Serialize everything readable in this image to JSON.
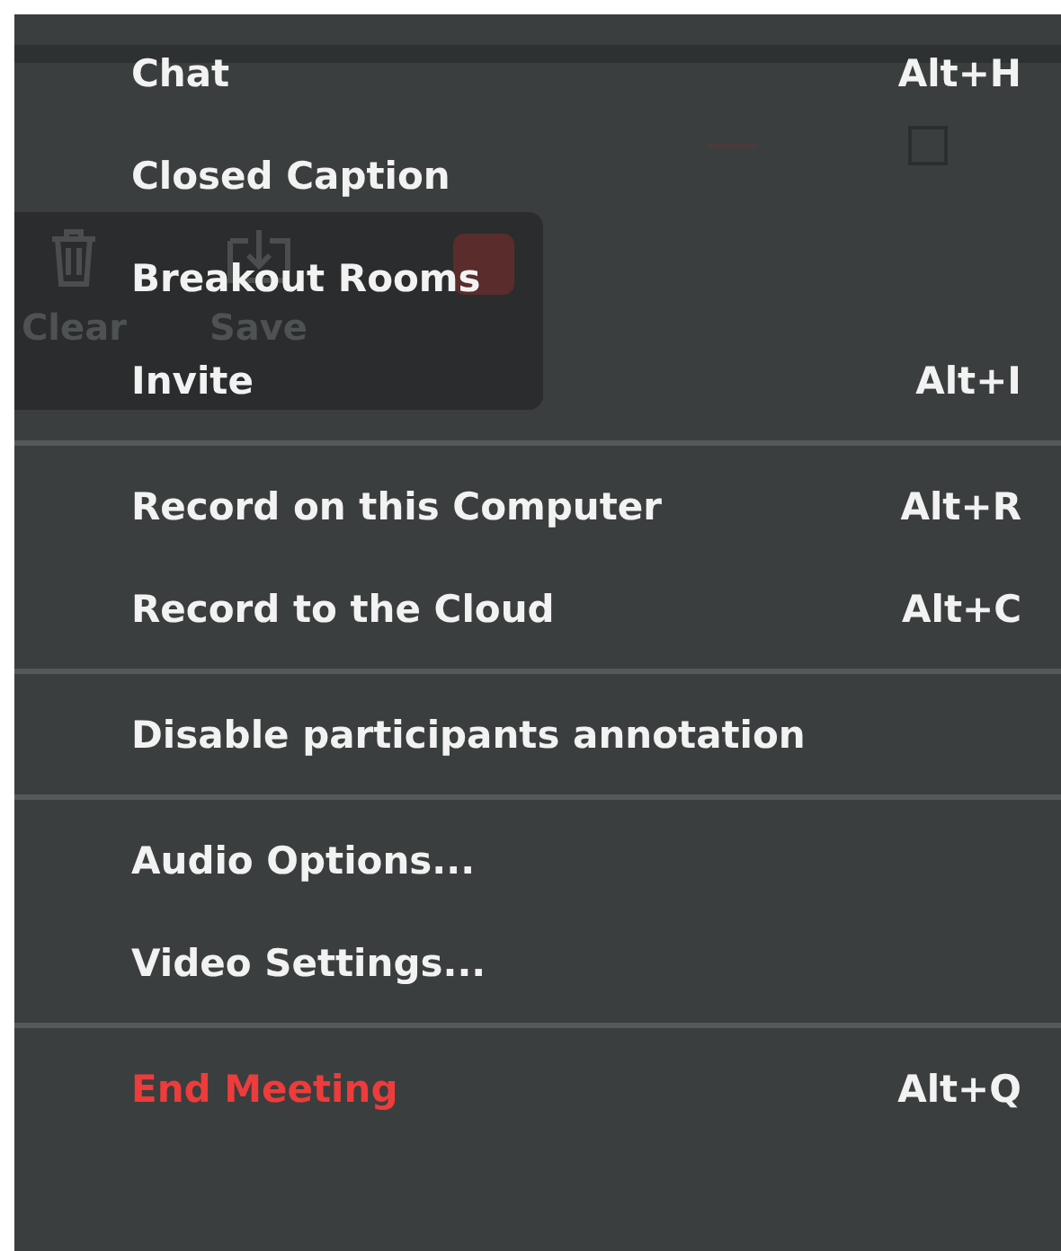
{
  "background_toolbar": {
    "buttons": [
      {
        "label": "Clear",
        "kind": "trash"
      },
      {
        "label": "Save",
        "kind": "save"
      }
    ]
  },
  "menu": {
    "groups": [
      {
        "items": [
          {
            "label": "Chat",
            "shortcut": "Alt+H",
            "kind": "normal"
          },
          {
            "label": "Closed Caption",
            "kind": "normal"
          },
          {
            "label": "Breakout Rooms",
            "kind": "normal"
          },
          {
            "label": "Invite",
            "shortcut": "Alt+I",
            "kind": "normal"
          }
        ]
      },
      {
        "items": [
          {
            "label": "Record on this Computer",
            "shortcut": "Alt+R",
            "kind": "normal"
          },
          {
            "label": "Record to the Cloud",
            "shortcut": "Alt+C",
            "kind": "normal"
          }
        ]
      },
      {
        "items": [
          {
            "label": "Disable participants annotation",
            "kind": "normal"
          }
        ]
      },
      {
        "items": [
          {
            "label": "Audio Options...",
            "kind": "normal"
          },
          {
            "label": "Video Settings...",
            "kind": "normal"
          }
        ]
      },
      {
        "items": [
          {
            "label": "End Meeting",
            "shortcut": "Alt+Q",
            "kind": "danger"
          }
        ]
      }
    ]
  }
}
